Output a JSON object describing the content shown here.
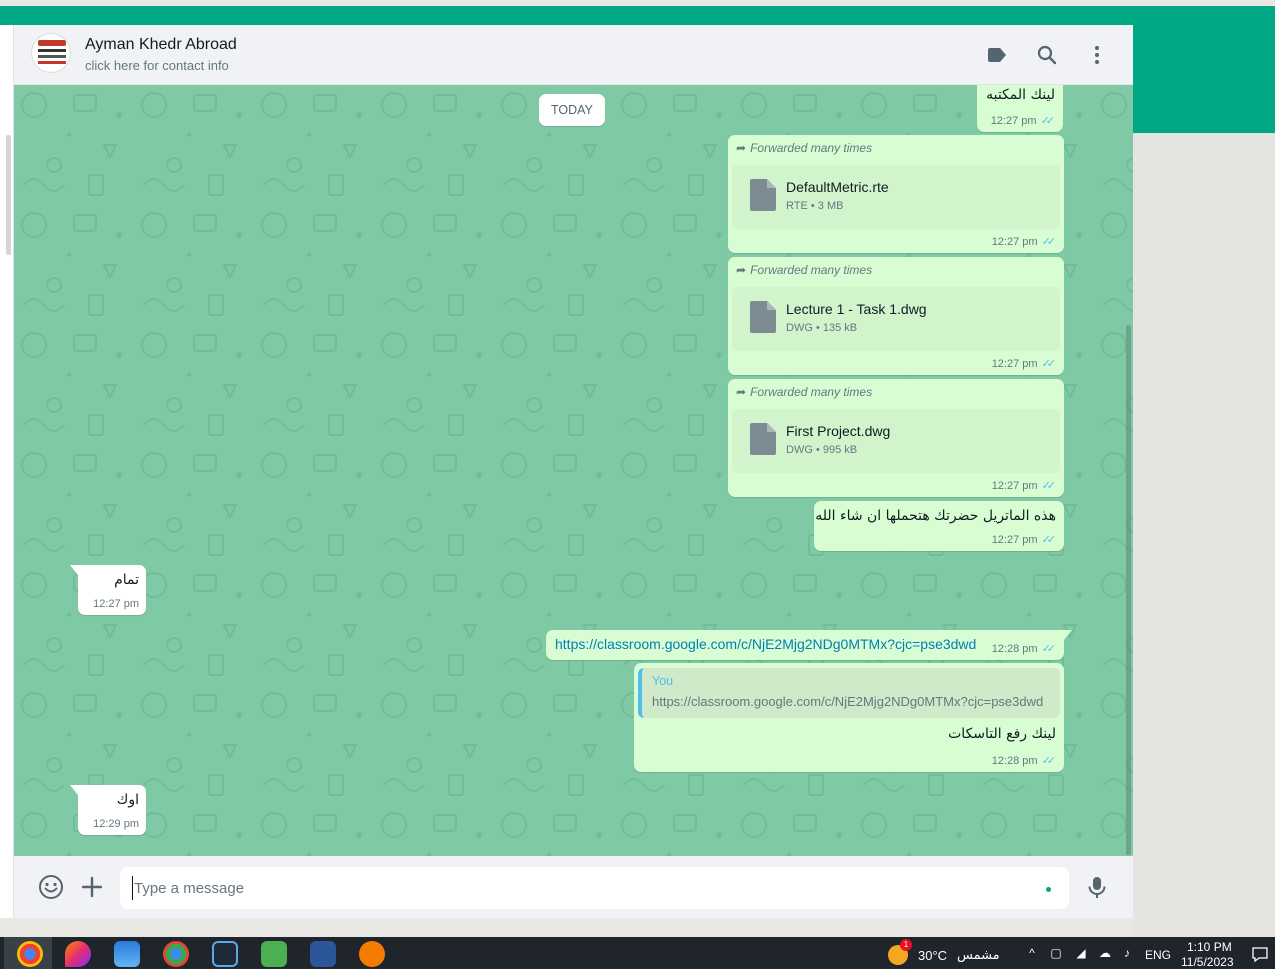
{
  "header": {
    "contact_name": "Ayman Khedr Abroad",
    "contact_sub": "click here for contact info",
    "icons": [
      "label-icon",
      "search-icon",
      "menu-icon"
    ]
  },
  "date_divider": "TODAY",
  "messages": [
    {
      "dir": "out",
      "text": "لينك المكتبه",
      "time": "12:27 pm"
    },
    {
      "dir": "out",
      "forwarded": "Forwarded many times",
      "file_name": "DefaultMetric.rte",
      "file_info": "RTE • 3 MB",
      "time": "12:27 pm"
    },
    {
      "dir": "out",
      "forwarded": "Forwarded many times",
      "file_name": "Lecture 1 - Task 1.dwg",
      "file_info": "DWG • 135 kB",
      "time": "12:27 pm"
    },
    {
      "dir": "out",
      "forwarded": "Forwarded many times",
      "file_name": "First Project.dwg",
      "file_info": "DWG • 995 kB",
      "time": "12:27 pm"
    },
    {
      "dir": "out",
      "text": "هذه الماتريل حضرتك هتحملها ان شاء الله",
      "time": "12:27 pm"
    },
    {
      "dir": "in",
      "text": "تمام",
      "time": "12:27 pm"
    },
    {
      "dir": "out",
      "link": "https://classroom.google.com/c/NjE2Mjg2NDg0MTMx?cjc=pse3dwd",
      "time": "12:28 pm"
    },
    {
      "dir": "out",
      "quote_author": "You",
      "quote_text": "https://classroom.google.com/c/NjE2Mjg2NDg0MTMx?cjc=pse3dwd",
      "text": "لينك رفع التاسكات",
      "time": "12:28 pm"
    },
    {
      "dir": "in",
      "text": "اوك",
      "time": "12:29 pm"
    }
  ],
  "ticks": "✓✓",
  "footer": {
    "placeholder": "Type a message",
    "icons": [
      "emoji-icon",
      "attach-plus-icon",
      "mic-icon"
    ]
  },
  "taskbar": {
    "weather_temp": "30°C",
    "weather_text": "مشمس",
    "weather_badge": "1",
    "language": "ENG",
    "time": "1:10 PM",
    "date": "11/5/2023"
  },
  "colors": {
    "brand": "#00a884",
    "chat_bg": "#7fc9a4",
    "outgoing": "#d9fdd3",
    "incoming": "#ffffff",
    "ticks": "#53bdeb"
  }
}
